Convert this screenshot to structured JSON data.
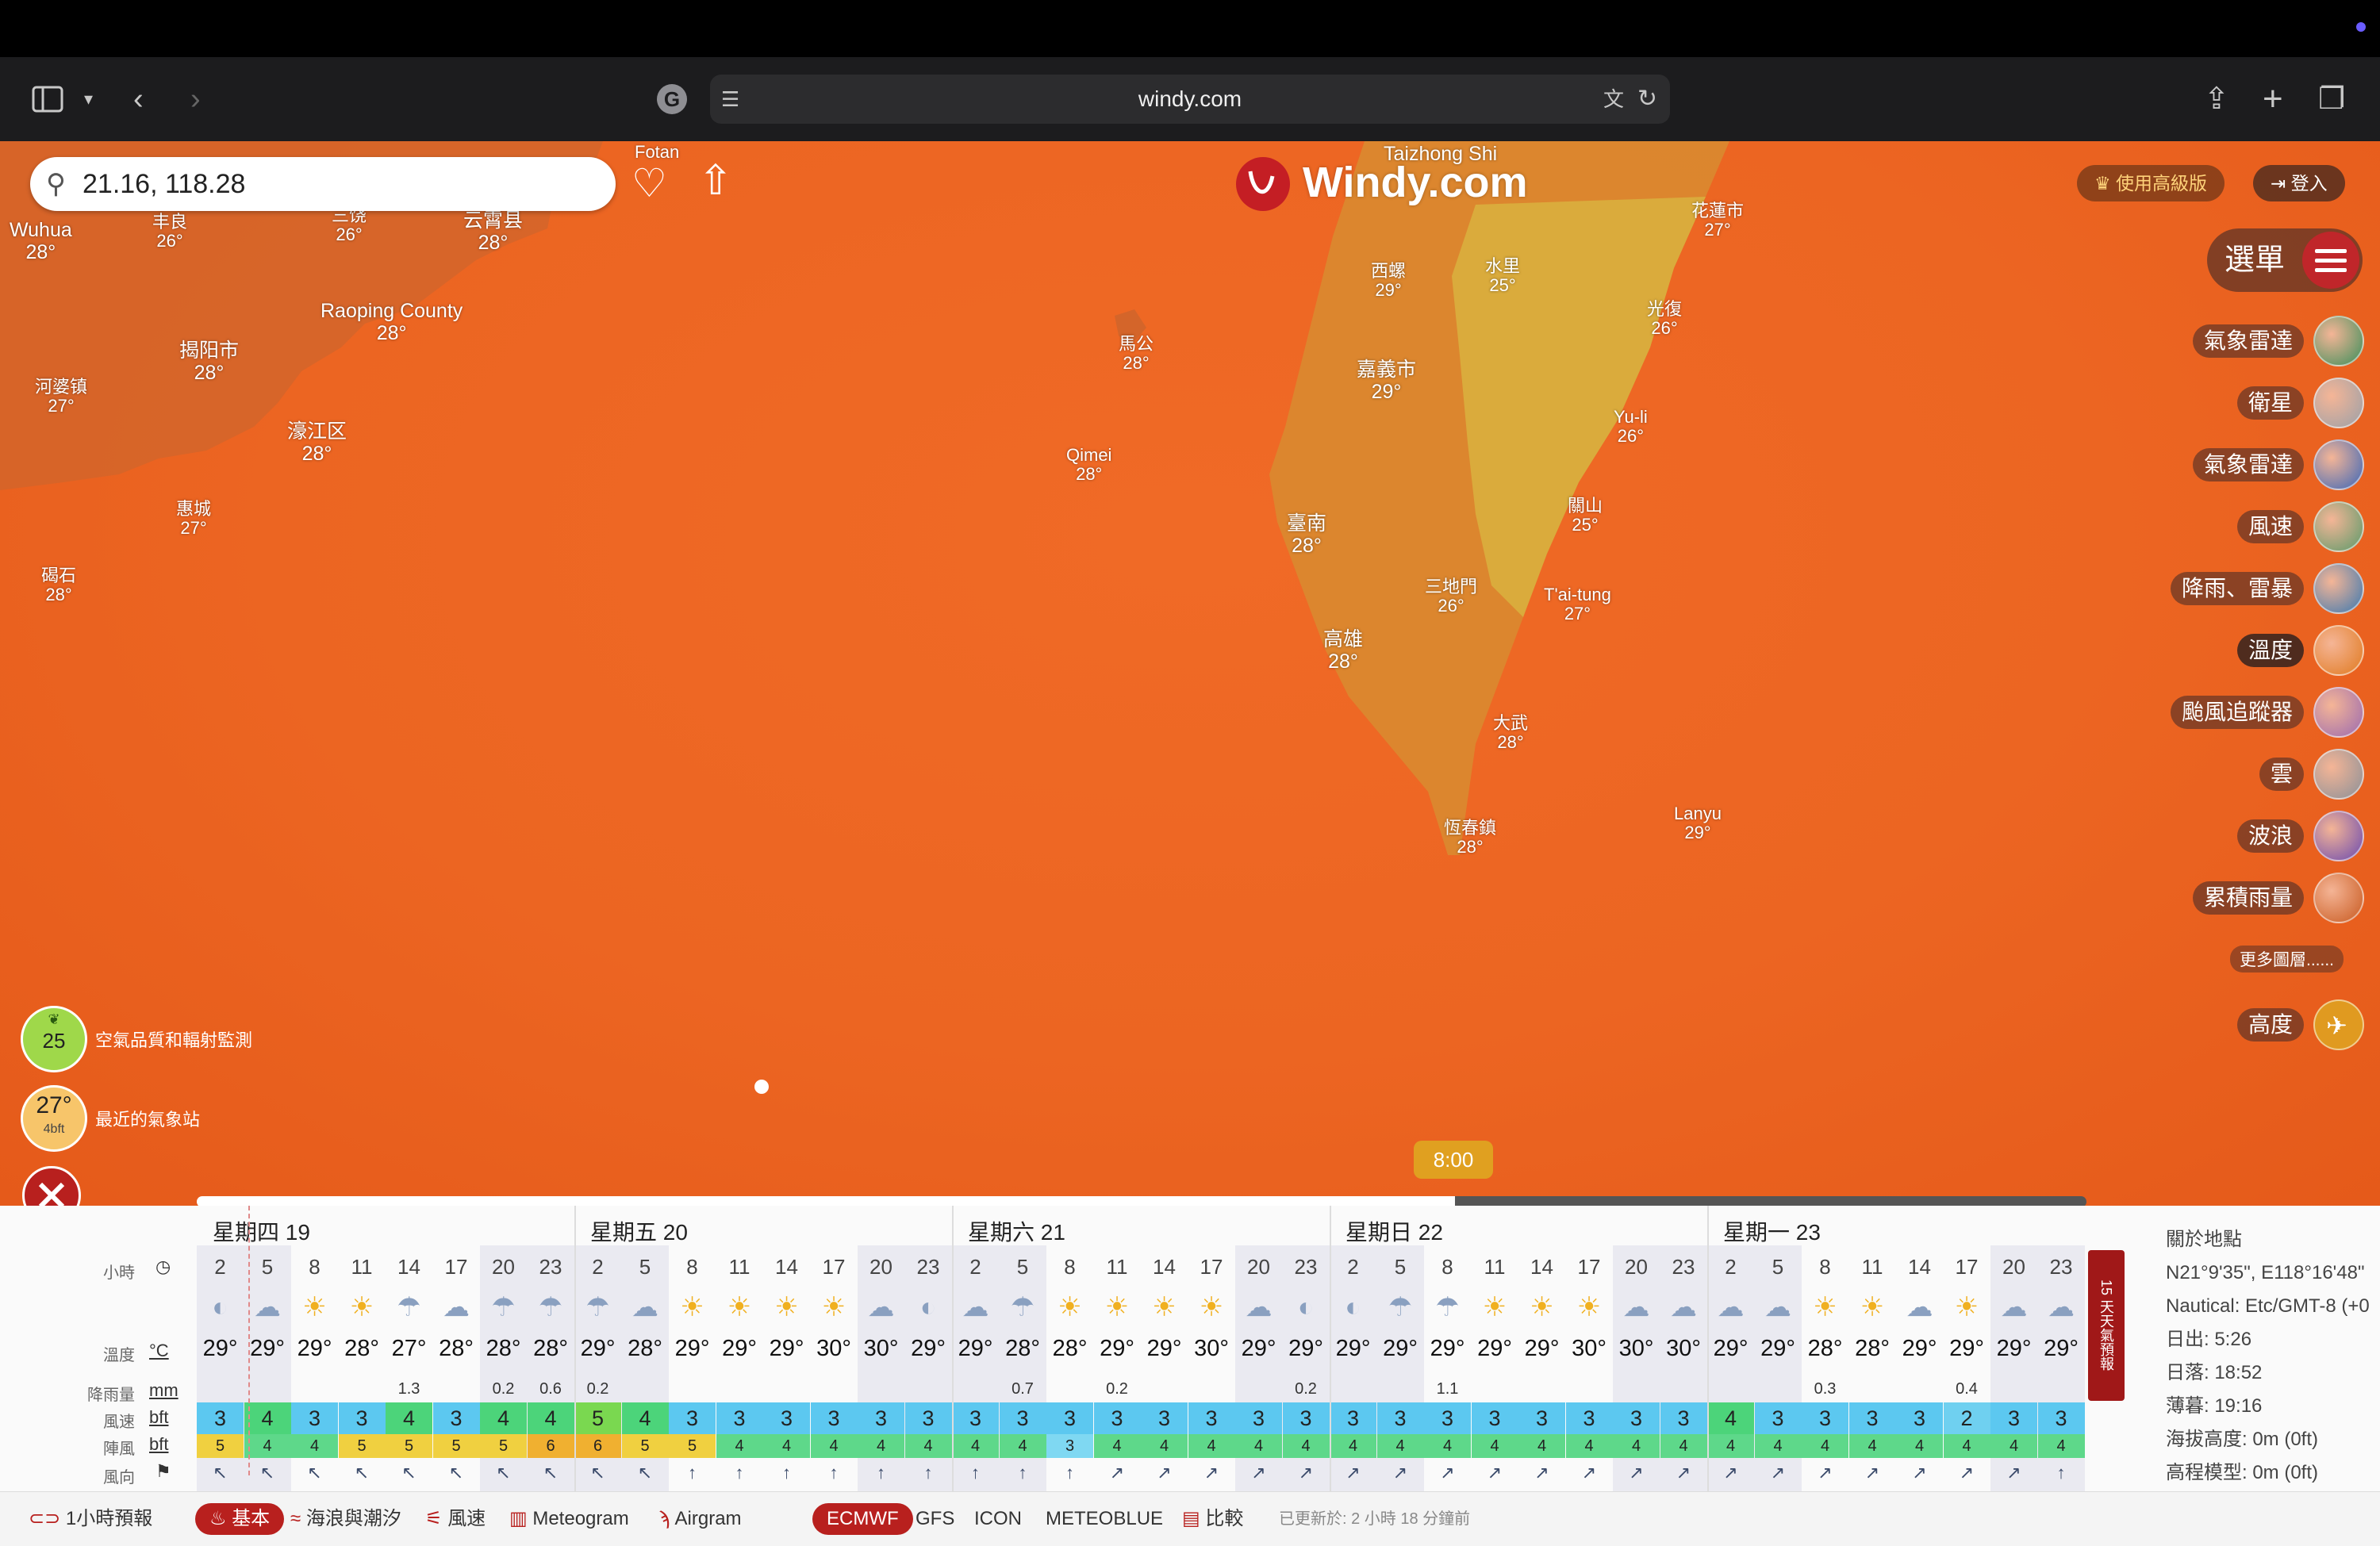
{
  "browser": {
    "url": "windy.com"
  },
  "map": {
    "search_value": "21.16, 118.28",
    "logo": "Windy.com",
    "premium_label": "使用高級版",
    "login_label": "登入",
    "menu_label": "選單",
    "layers": [
      {
        "label": "氣象雷達",
        "color": "#3a8e5a"
      },
      {
        "label": "衛星",
        "color": "#9aa0a8"
      },
      {
        "label": "氣象雷達",
        "color": "#3a66b8"
      },
      {
        "label": "風速",
        "color": "#5a9a6a"
      },
      {
        "label": "降雨、雷暴",
        "color": "#3a78b0"
      },
      {
        "label": "溫度",
        "color": "#e07a20"
      },
      {
        "label": "颱風追蹤器",
        "color": "#9a6ab0"
      },
      {
        "label": "雲",
        "color": "#8a9098"
      },
      {
        "label": "波浪",
        "color": "#6a4ab0"
      },
      {
        "label": "累積雨量",
        "color": "#c85a20"
      }
    ],
    "more_layers": "更多圖層......",
    "altitude_label": "高度",
    "air_quality_value": "25",
    "air_quality_label": "空氣品質和輻射監測",
    "station_temp": "27°",
    "station_wind": "4bft",
    "station_label": "最近的氣象站",
    "timeline_time": "8:00",
    "places": [
      {
        "name": "Fotan",
        "temp": ""
      },
      {
        "name": "Wuhua",
        "temp": "28°"
      },
      {
        "name": "丰良",
        "temp": "26°"
      },
      {
        "name": "三饶",
        "temp": "26°"
      },
      {
        "name": "云霄县",
        "temp": "28°"
      },
      {
        "name": "Raoping County",
        "temp": "28°"
      },
      {
        "name": "揭阳市",
        "temp": "28°"
      },
      {
        "name": "河婆镇",
        "temp": "27°"
      },
      {
        "name": "濠江区",
        "temp": "28°"
      },
      {
        "name": "惠城",
        "temp": "27°"
      },
      {
        "name": "碣石",
        "temp": "28°"
      },
      {
        "name": "Taizhong Shi",
        "temp": ""
      },
      {
        "name": "花蓮市",
        "temp": "27°"
      },
      {
        "name": "西螺",
        "temp": "29°"
      },
      {
        "name": "水里",
        "temp": "25°"
      },
      {
        "name": "馬公",
        "temp": "28°"
      },
      {
        "name": "嘉義市",
        "temp": "29°"
      },
      {
        "name": "光復",
        "temp": "26°"
      },
      {
        "name": "Yu-li",
        "temp": "26°"
      },
      {
        "name": "Qimei",
        "temp": "28°"
      },
      {
        "name": "臺南",
        "temp": "28°"
      },
      {
        "name": "關山",
        "temp": "25°"
      },
      {
        "name": "三地門",
        "temp": "26°"
      },
      {
        "name": "T'ai-tung",
        "temp": "27°"
      },
      {
        "name": "高雄",
        "temp": "28°"
      },
      {
        "name": "大武",
        "temp": "28°"
      },
      {
        "name": "Lanyu",
        "temp": "29°"
      },
      {
        "name": "恆春鎮",
        "temp": "28°"
      }
    ]
  },
  "forecast": {
    "days": [
      "星期四 19",
      "星期五 20",
      "星期六 21",
      "星期日 22",
      "星期一 23"
    ],
    "labels": {
      "hours": "小時",
      "temp": "溫度",
      "temp_unit": "°C",
      "rain": "降雨量",
      "rain_unit": "mm",
      "wind": "風速",
      "wind_unit": "bft",
      "gust": "陣風",
      "gust_unit": "bft",
      "dir": "風向"
    },
    "hours": [
      "2",
      "5",
      "8",
      "11",
      "14",
      "17",
      "20",
      "23",
      "2",
      "5",
      "8",
      "11",
      "14",
      "17",
      "20",
      "23",
      "2",
      "5",
      "8",
      "11",
      "14",
      "17",
      "20",
      "23",
      "2",
      "5",
      "8",
      "11",
      "14",
      "17",
      "20",
      "23",
      "2",
      "5",
      "8",
      "11",
      "14",
      "17",
      "20",
      "23"
    ],
    "icons": [
      "◐",
      "☁",
      "☀",
      "☀",
      "☂",
      "☁",
      "☂",
      "☂",
      "☂",
      "☁",
      "☀",
      "☀",
      "☀",
      "☀",
      "☁",
      "◐",
      "☁",
      "☂",
      "☀",
      "☀",
      "☀",
      "☀",
      "☁",
      "◐",
      "◐",
      "☂",
      "☂",
      "☀",
      "☀",
      "☀",
      "☁",
      "☁",
      "☁",
      "☁",
      "☀",
      "☀",
      "☁",
      "☀",
      "☁",
      "☁"
    ],
    "temps": [
      "29°",
      "29°",
      "29°",
      "28°",
      "27°",
      "28°",
      "28°",
      "28°",
      "29°",
      "28°",
      "29°",
      "29°",
      "29°",
      "30°",
      "30°",
      "29°",
      "29°",
      "28°",
      "28°",
      "29°",
      "29°",
      "30°",
      "29°",
      "29°",
      "29°",
      "29°",
      "29°",
      "29°",
      "29°",
      "30°",
      "30°",
      "30°",
      "29°",
      "29°",
      "28°",
      "28°",
      "29°",
      "29°",
      "29°",
      "29°"
    ],
    "rain": [
      "",
      "",
      "",
      "",
      "1.3",
      "",
      "0.2",
      "0.6",
      "0.2",
      "",
      "",
      "",
      "",
      "",
      "",
      "",
      "",
      "0.7",
      "",
      "0.2",
      "",
      "",
      "",
      "0.2",
      "",
      "",
      "1.1",
      "",
      "",
      "",
      "",
      "",
      "",
      "",
      "0.3",
      "",
      "",
      "0.4",
      "",
      ""
    ],
    "wind": [
      "3",
      "4",
      "3",
      "3",
      "4",
      "3",
      "4",
      "4",
      "5",
      "4",
      "3",
      "3",
      "3",
      "3",
      "3",
      "3",
      "3",
      "3",
      "3",
      "3",
      "3",
      "3",
      "3",
      "3",
      "3",
      "3",
      "3",
      "3",
      "3",
      "3",
      "3",
      "3",
      "4",
      "3",
      "3",
      "3",
      "3",
      "2",
      "3",
      "3"
    ],
    "gust": [
      "5",
      "4",
      "4",
      "5",
      "5",
      "5",
      "5",
      "6",
      "6",
      "5",
      "5",
      "4",
      "4",
      "4",
      "4",
      "4",
      "4",
      "4",
      "3",
      "4",
      "4",
      "4",
      "4",
      "4",
      "4",
      "4",
      "4",
      "4",
      "4",
      "4",
      "4",
      "4",
      "4",
      "4",
      "4",
      "4",
      "4",
      "4",
      "4",
      "4"
    ],
    "dirs": [
      "↖",
      "↖",
      "↖",
      "↖",
      "↖",
      "↖",
      "↖",
      "↖",
      "↖",
      "↖",
      "↑",
      "↑",
      "↑",
      "↑",
      "↑",
      "↑",
      "↑",
      "↑",
      "↑",
      "↗",
      "↗",
      "↗",
      "↗",
      "↗",
      "↗",
      "↗",
      "↗",
      "↗",
      "↗",
      "↗",
      "↗",
      "↗",
      "↗",
      "↗",
      "↗",
      "↗",
      "↗",
      "↗",
      "↗",
      "↑"
    ],
    "info": {
      "title": "關於地點",
      "coords": "N21°9'35\", E118°16'48\"",
      "timezone": "Nautical: Etc/GMT-8 (+0",
      "sunrise": "日出: 5:26",
      "sunset": "日落: 18:52",
      "dusk": "薄暮: 19:16",
      "elevation": "海拔高度: 0m (0ft)",
      "model_elevation": "高程模型: 0m (0ft)"
    },
    "tab15": "15 天天氣預報"
  },
  "bottombar": {
    "hourly": "1小時預報",
    "basic": "基本",
    "waves": "海浪與潮汐",
    "wind": "風速",
    "meteogram": "Meteogram",
    "airgram": "Airgram",
    "models": [
      "ECMWF",
      "GFS",
      "ICON",
      "METEOBLUE"
    ],
    "compare": "比較",
    "updated": "已更新於: 2 小時 18 分鐘前"
  }
}
